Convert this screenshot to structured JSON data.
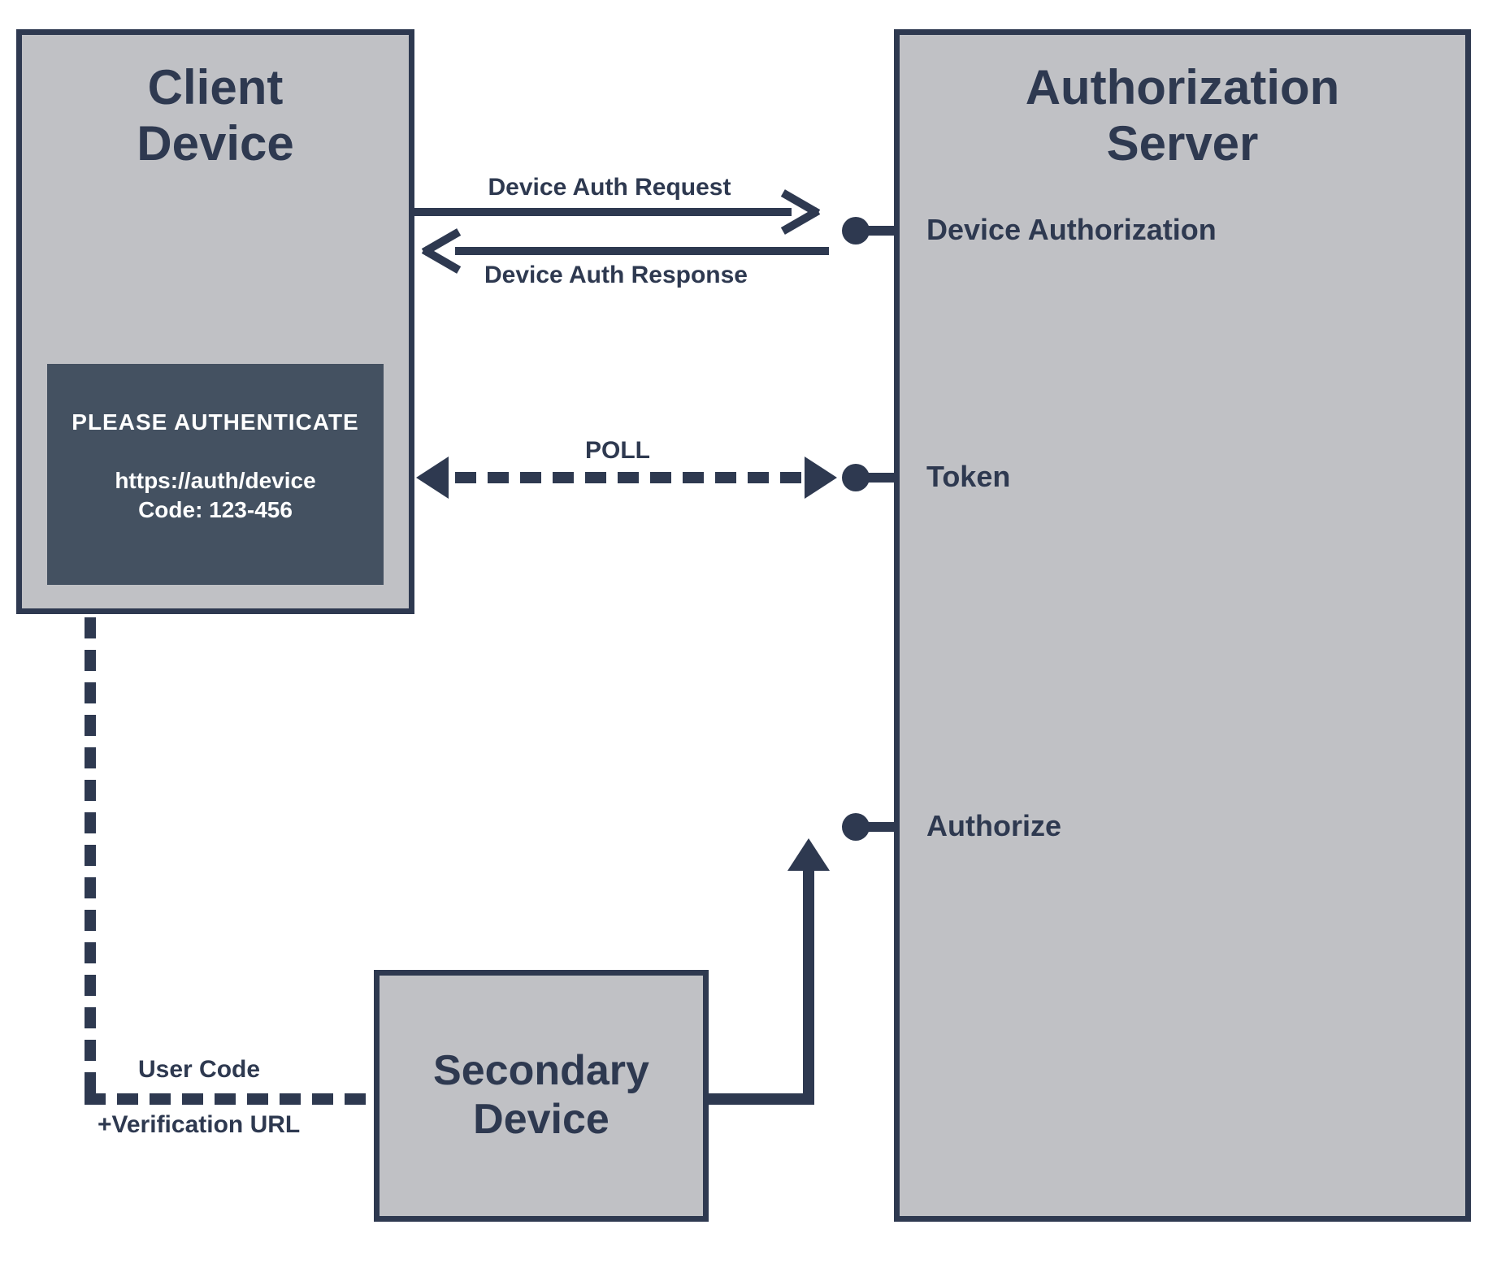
{
  "client": {
    "title_line1": "Client",
    "title_line2": "Device",
    "panel": {
      "header": "PLEASE AUTHENTICATE",
      "url": "https://auth/device",
      "code": "Code: 123-456"
    }
  },
  "auth_server": {
    "title_line1": "Authorization",
    "title_line2": "Server",
    "endpoints": {
      "device_auth": "Device Authorization",
      "token": "Token",
      "authorize": "Authorize"
    }
  },
  "secondary": {
    "title_line1": "Secondary",
    "title_line2": "Device"
  },
  "flows": {
    "device_auth_request": "Device Auth Request",
    "device_auth_response": "Device Auth Response",
    "poll": "POLL",
    "user_code": "User Code",
    "verification_url": "+Verification URL"
  }
}
